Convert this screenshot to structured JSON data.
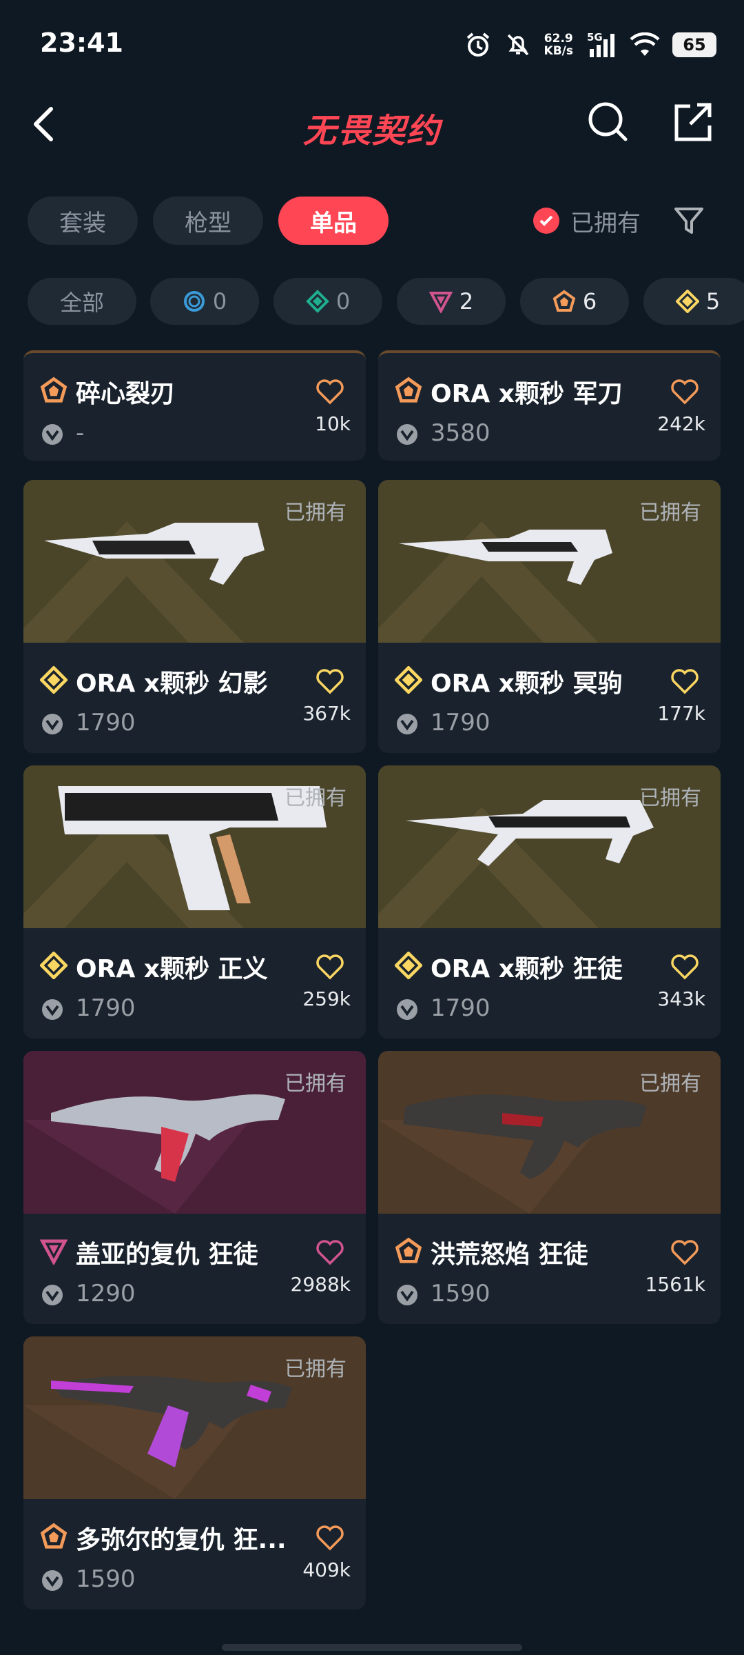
{
  "status": {
    "time": "23:41",
    "net_speed_value": "62.9",
    "net_speed_unit": "KB/s",
    "network": "5G",
    "battery": "65"
  },
  "header": {
    "title": "无畏契约",
    "back_icon": "back-arrow-icon",
    "search_icon": "search-icon",
    "share_icon": "share-icon"
  },
  "tabs": [
    {
      "label": "套装",
      "active": false
    },
    {
      "label": "枪型",
      "active": false
    },
    {
      "label": "单品",
      "active": true
    }
  ],
  "owned_filter": {
    "label": "已拥有",
    "checked": true
  },
  "tier_chips": [
    {
      "label": "全部"
    },
    {
      "count": "0",
      "tier": "select",
      "color": "#3a9bd8"
    },
    {
      "count": "0",
      "tier": "deluxe",
      "color": "#1fae8f"
    },
    {
      "count": "2",
      "tier": "premium",
      "color": "#d1548e"
    },
    {
      "count": "6",
      "tier": "exclusive",
      "color": "#f59b5a"
    },
    {
      "count": "5",
      "tier": "ultra",
      "color": "#fad663"
    }
  ],
  "cards": [
    {
      "name": "碎心裂刃",
      "price": "-",
      "likes": "10k",
      "tier": "exclusive",
      "owned_label": ""
    },
    {
      "name": "ORA x颗秒 军刀",
      "price": "3580",
      "likes": "242k",
      "tier": "exclusive",
      "owned_label": ""
    },
    {
      "name": "ORA x颗秒 幻影",
      "price": "1790",
      "likes": "367k",
      "tier": "ultra",
      "owned_label": "已拥有"
    },
    {
      "name": "ORA x颗秒 冥驹",
      "price": "1790",
      "likes": "177k",
      "tier": "ultra",
      "owned_label": "已拥有"
    },
    {
      "name": "ORA x颗秒 正义",
      "price": "1790",
      "likes": "259k",
      "tier": "ultra",
      "owned_label": "已拥有"
    },
    {
      "name": "ORA x颗秒 狂徒",
      "price": "1790",
      "likes": "343k",
      "tier": "ultra",
      "owned_label": "已拥有"
    },
    {
      "name": "盖亚的复仇 狂徒",
      "price": "1290",
      "likes": "2988k",
      "tier": "premium",
      "owned_label": "已拥有"
    },
    {
      "name": "洪荒怒焰 狂徒",
      "price": "1590",
      "likes": "1561k",
      "tier": "exclusive",
      "owned_label": "已拥有"
    },
    {
      "name": "多弥尔的复仇 狂...",
      "price": "1590",
      "likes": "409k",
      "tier": "exclusive",
      "owned_label": "已拥有"
    }
  ],
  "colors": {
    "accent": "#ff4655",
    "ultra": "#fad663",
    "exclusive": "#f59b5a",
    "premium": "#d1548e"
  }
}
